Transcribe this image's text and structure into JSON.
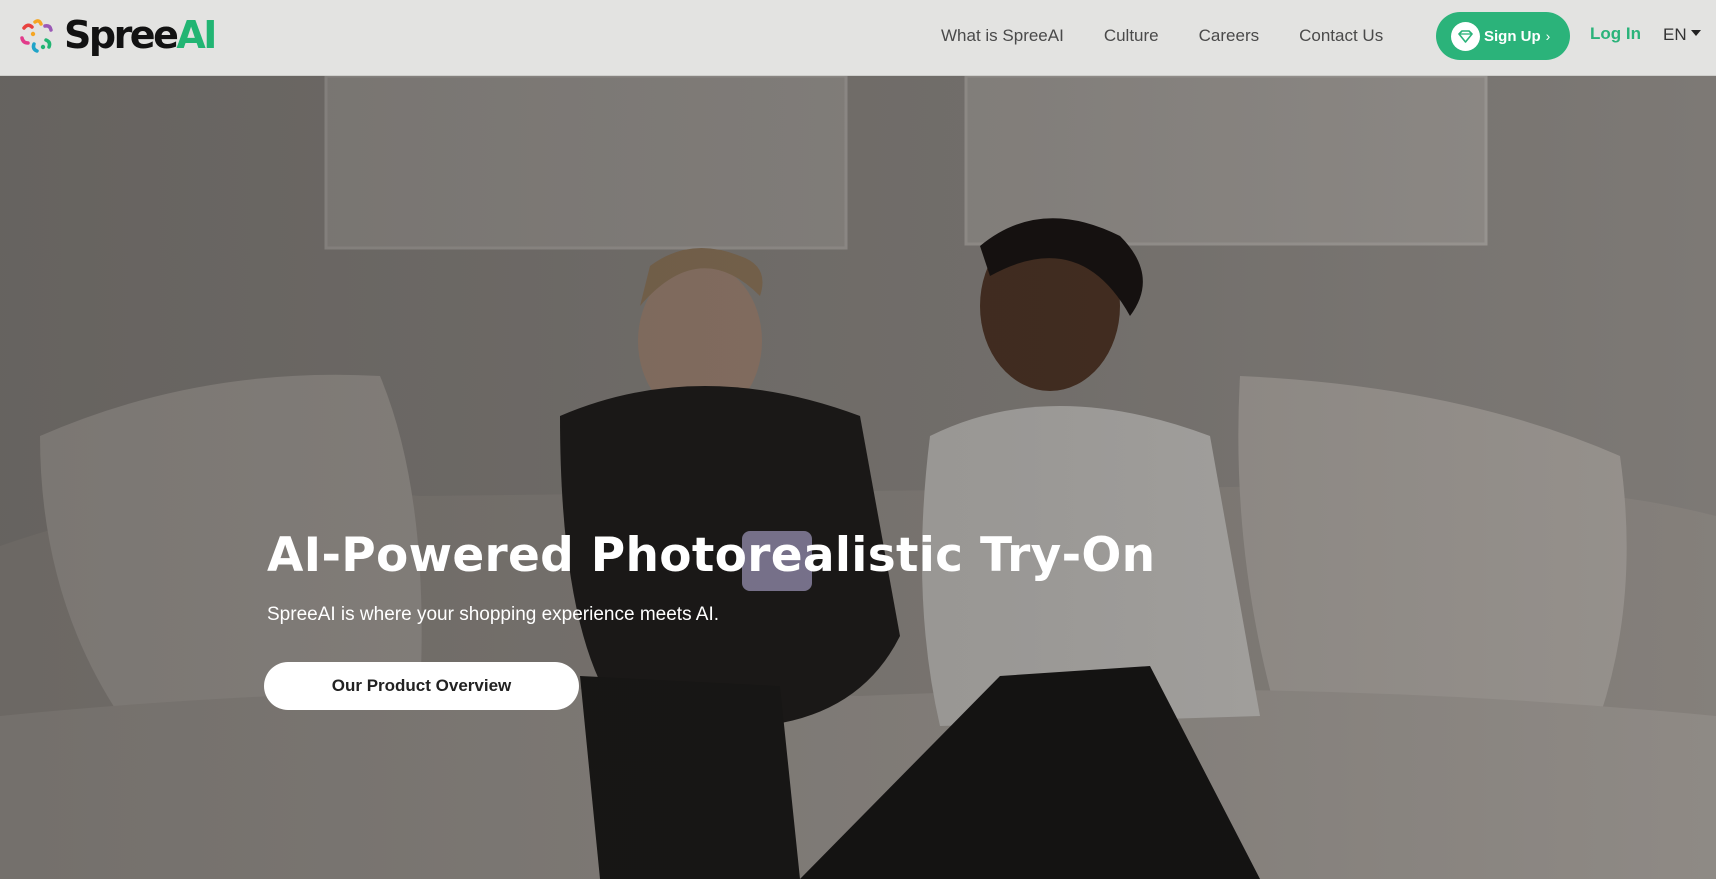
{
  "brand": {
    "name_main": "Spree",
    "name_accent": "AI",
    "accent_color": "#22b573",
    "logo_icon": "confetti-logo-icon"
  },
  "nav": {
    "items": [
      {
        "label": "What is SpreeAI"
      },
      {
        "label": "Culture"
      },
      {
        "label": "Careers"
      },
      {
        "label": "Contact Us"
      }
    ],
    "signup_label": "Sign Up",
    "signup_icon": "diamond-icon",
    "login_label": "Log In",
    "language": "EN"
  },
  "hero": {
    "title": "AI-Powered Photorealistic Try-On",
    "subtitle": "SpreeAI is where your shopping experience meets AI.",
    "cta_label": "Our Product Overview"
  },
  "colors": {
    "primary_green": "#2bb37a",
    "header_bg": "#e3e3e1"
  }
}
